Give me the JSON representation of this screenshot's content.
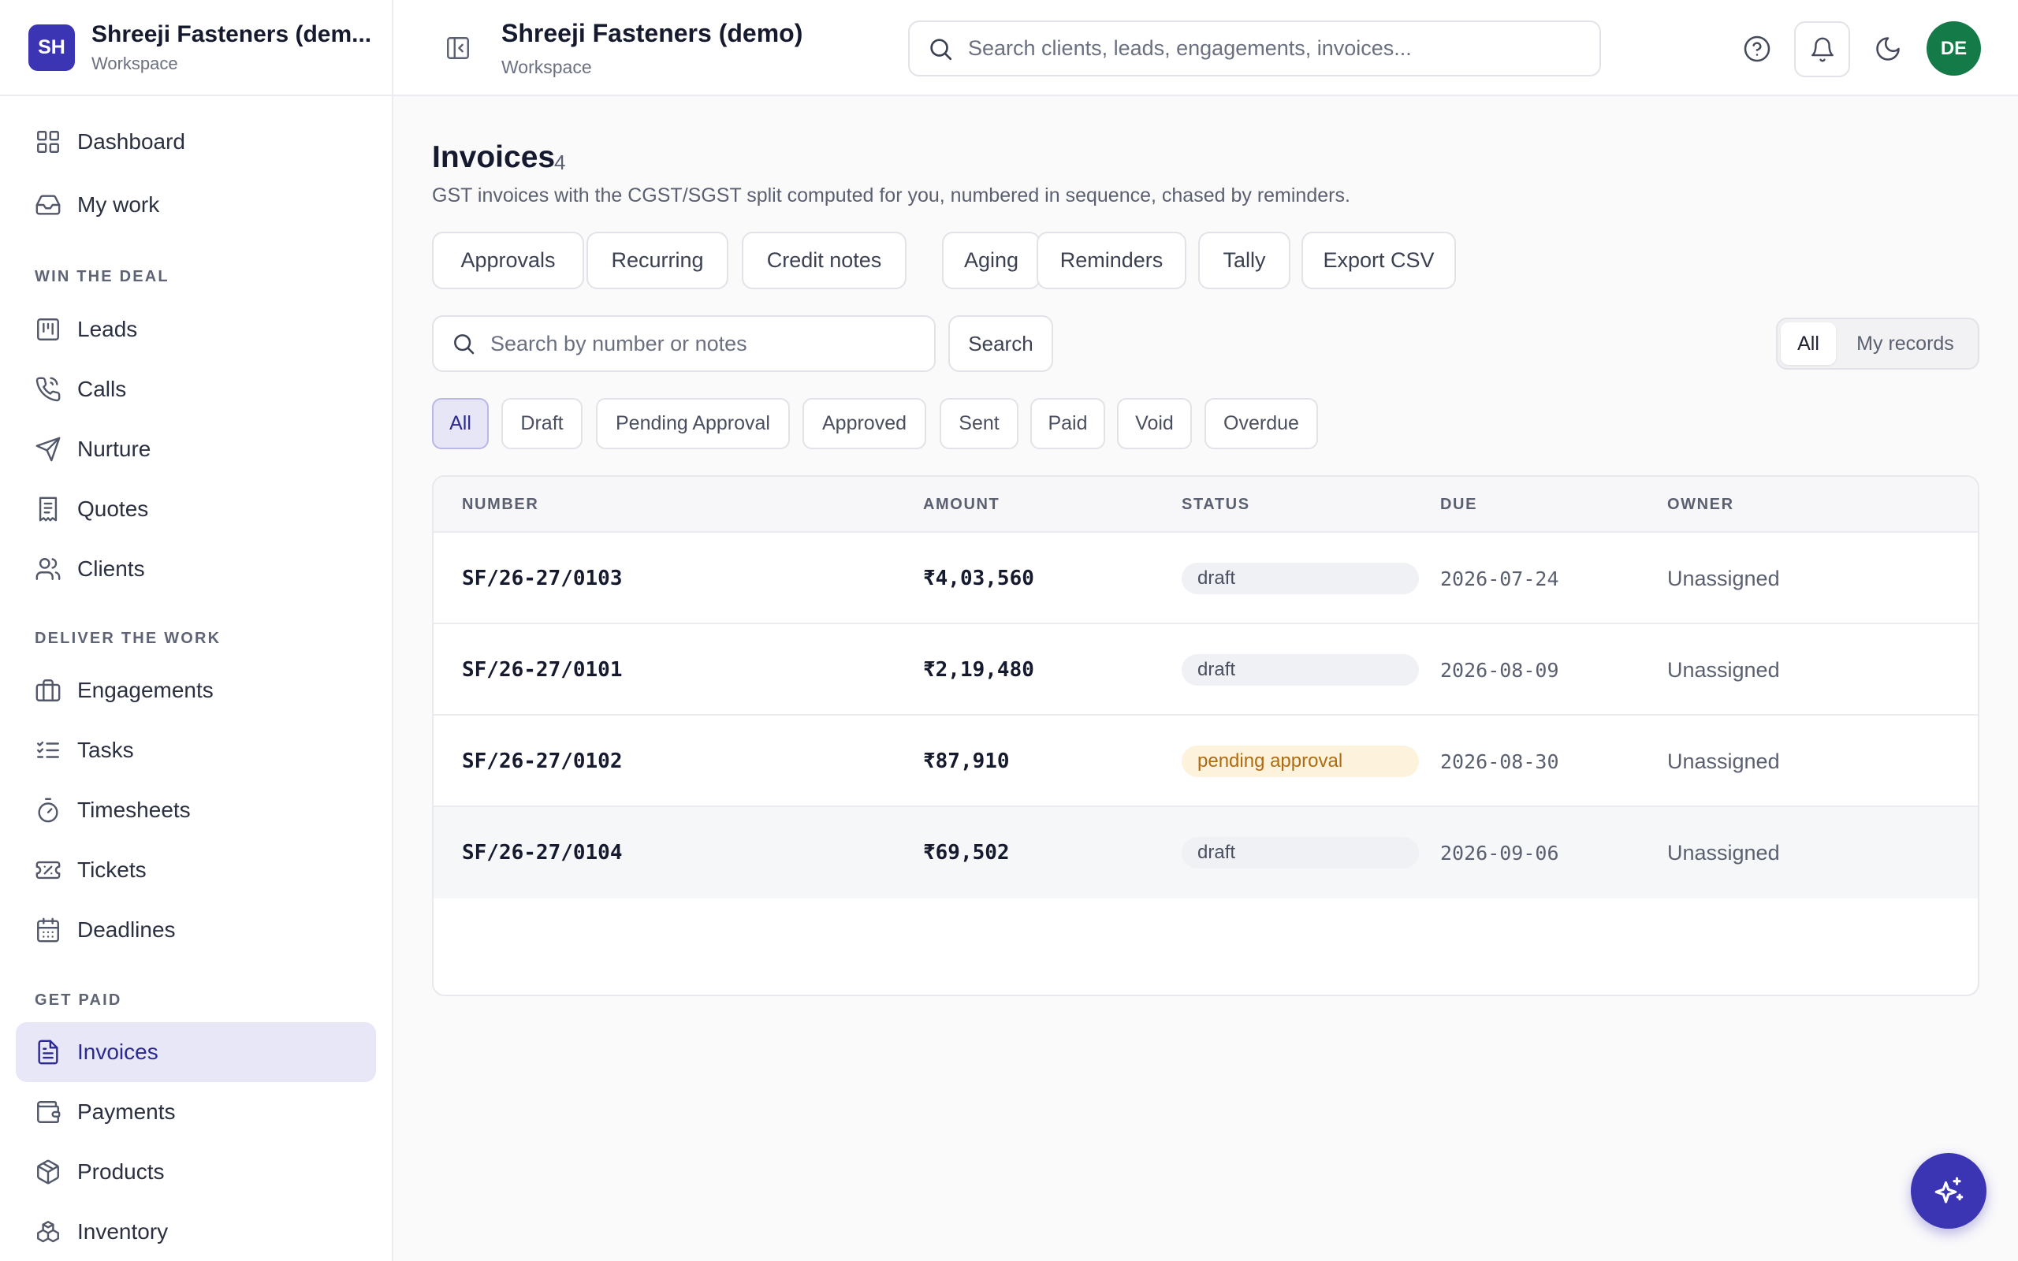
{
  "workspace": {
    "initials": "SH",
    "name": "Shreeji Fasteners (dem...",
    "sub": "Workspace"
  },
  "nav": {
    "top": [
      {
        "label": "Dashboard",
        "icon": "grid-icon"
      },
      {
        "label": "My work",
        "icon": "inbox-icon"
      }
    ],
    "sections": [
      {
        "title": "WIN THE DEAL"
      },
      {
        "title": "DELIVER THE WORK"
      },
      {
        "title": "GET PAID"
      }
    ],
    "items": [
      {
        "label": "Leads",
        "icon": "kanban-icon"
      },
      {
        "label": "Calls",
        "icon": "phone-icon"
      },
      {
        "label": "Nurture",
        "icon": "send-icon"
      },
      {
        "label": "Quotes",
        "icon": "receipt-icon"
      },
      {
        "label": "Clients",
        "icon": "users-icon"
      },
      {
        "label": "Engagements",
        "icon": "briefcase-icon"
      },
      {
        "label": "Tasks",
        "icon": "checklist-icon"
      },
      {
        "label": "Timesheets",
        "icon": "timer-icon"
      },
      {
        "label": "Tickets",
        "icon": "ticket-icon"
      },
      {
        "label": "Deadlines",
        "icon": "calendar-icon"
      },
      {
        "label": "Invoices",
        "icon": "file-text-icon",
        "active": true
      },
      {
        "label": "Payments",
        "icon": "wallet-icon"
      },
      {
        "label": "Products",
        "icon": "package-icon"
      },
      {
        "label": "Inventory",
        "icon": "boxes-icon"
      }
    ]
  },
  "topbar": {
    "title": "Shreeji Fasteners (demo)",
    "sub": "Workspace",
    "search_placeholder": "Search clients, leads, engagements, invoices...",
    "avatar": "DE"
  },
  "page": {
    "title": "Invoices",
    "count": "4",
    "description": "GST invoices with the CGST/SGST split computed for you, numbered in sequence, chased by reminders."
  },
  "tool_tabs": [
    "Approvals",
    "Recurring",
    "Credit notes",
    "Aging",
    "Reminders",
    "Tally",
    "Export CSV"
  ],
  "list_search": {
    "placeholder": "Search by number or notes",
    "button": "Search"
  },
  "scope": {
    "options": [
      "All",
      "My records"
    ],
    "selected": "All"
  },
  "filters": {
    "chips": [
      "All",
      "Draft",
      "Pending Approval",
      "Approved",
      "Sent",
      "Paid",
      "Void",
      "Overdue"
    ],
    "selected": "All"
  },
  "table": {
    "columns": [
      "NUMBER",
      "AMOUNT",
      "STATUS",
      "DUE",
      "OWNER"
    ],
    "rows": [
      {
        "number": "SF/26-27/0103",
        "amount": "₹4,03,560",
        "status": "draft",
        "due": "2026-07-24",
        "owner": "Unassigned"
      },
      {
        "number": "SF/26-27/0101",
        "amount": "₹2,19,480",
        "status": "draft",
        "due": "2026-08-09",
        "owner": "Unassigned"
      },
      {
        "number": "SF/26-27/0102",
        "amount": "₹87,910",
        "status": "pending approval",
        "due": "2026-08-30",
        "owner": "Unassigned"
      },
      {
        "number": "SF/26-27/0104",
        "amount": "₹69,502",
        "status": "draft",
        "due": "2026-09-06",
        "owner": "Unassigned"
      }
    ]
  },
  "colors": {
    "accent": "#3b35b4",
    "avatar": "#137a48",
    "pending_bg": "#fdf3dc",
    "pending_fg": "#b06a12"
  }
}
